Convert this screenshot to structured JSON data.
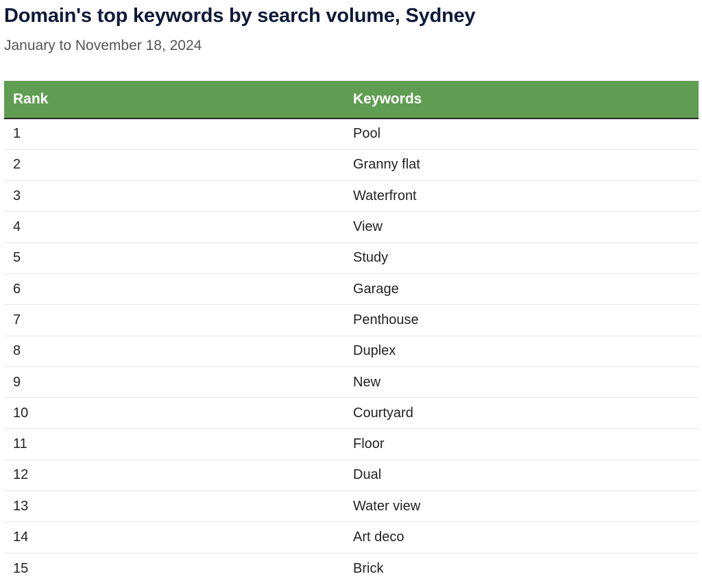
{
  "title": "Domain's top keywords by search volume, Sydney",
  "subtitle": "January to November 18, 2024",
  "colors": {
    "header_background": "#5f9e52",
    "header_text": "#ffffff",
    "title_text": "#0f1a3a"
  },
  "chart_data": {
    "type": "table",
    "title": "Domain's top keywords by search volume, Sydney",
    "subtitle": "January to November 18, 2024",
    "columns": [
      "Rank",
      "Keywords"
    ],
    "rows": [
      [
        "1",
        "Pool"
      ],
      [
        "2",
        "Granny flat"
      ],
      [
        "3",
        "Waterfront"
      ],
      [
        "4",
        "View"
      ],
      [
        "5",
        "Study"
      ],
      [
        "6",
        "Garage"
      ],
      [
        "7",
        "Penthouse"
      ],
      [
        "8",
        "Duplex"
      ],
      [
        "9",
        "New"
      ],
      [
        "10",
        "Courtyard"
      ],
      [
        "11",
        "Floor"
      ],
      [
        "12",
        "Dual"
      ],
      [
        "13",
        "Water view"
      ],
      [
        "14",
        "Art deco"
      ],
      [
        "15",
        "Brick"
      ]
    ]
  }
}
